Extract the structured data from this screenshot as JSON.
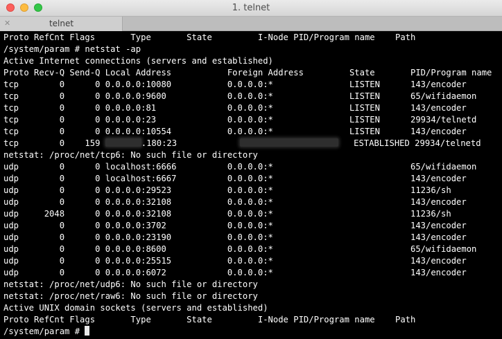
{
  "window": {
    "title": "1. telnet"
  },
  "tab": {
    "label": "telnet",
    "close_glyph": "✕"
  },
  "terminal": {
    "lines": [
      "Proto RefCnt Flags       Type       State         I-Node PID/Program name    Path",
      "/system/param # netstat -ap",
      "Active Internet connections (servers and established)",
      "Proto Recv-Q Send-Q Local Address           Foreign Address         State       PID/Program name",
      "tcp        0      0 0.0.0.0:10080           0.0.0.0:*               LISTEN      143/encoder",
      "tcp        0      0 0.0.0.0:9600            0.0.0.0:*               LISTEN      65/wifidaemon",
      "tcp        0      0 0.0.0.0:81              0.0.0.0:*               LISTEN      143/encoder",
      "tcp        0      0 0.0.0.0:23              0.0.0.0:*               LISTEN      29934/telnetd",
      "tcp        0      0 0.0.0.0:10554           0.0.0.0:*               LISTEN      143/encoder"
    ],
    "redacted_line": {
      "prefix": "tcp        0    159 ",
      "local_suffix": ".180:23",
      "suffix": "ESTABLISHED 29934/telnetd"
    },
    "lines_after": [
      "netstat: /proc/net/tcp6: No such file or directory",
      "udp        0      0 localhost:6666          0.0.0.0:*                           65/wifidaemon",
      "udp        0      0 localhost:6667          0.0.0.0:*                           143/encoder",
      "udp        0      0 0.0.0.0:29523           0.0.0.0:*                           11236/sh",
      "udp        0      0 0.0.0.0:32108           0.0.0.0:*                           143/encoder",
      "udp     2048      0 0.0.0.0:32108           0.0.0.0:*                           11236/sh",
      "udp        0      0 0.0.0.0:3702            0.0.0.0:*                           143/encoder",
      "udp        0      0 0.0.0.0:23190           0.0.0.0:*                           143/encoder",
      "udp        0      0 0.0.0.0:8600            0.0.0.0:*                           65/wifidaemon",
      "udp        0      0 0.0.0.0:25515           0.0.0.0:*                           143/encoder",
      "udp        0      0 0.0.0.0:6072            0.0.0.0:*                           143/encoder",
      "netstat: /proc/net/udp6: No such file or directory",
      "netstat: /proc/net/raw6: No such file or directory",
      "Active UNIX domain sockets (servers and established)",
      "Proto RefCnt Flags       Type       State         I-Node PID/Program name    Path"
    ],
    "prompt": "/system/param # "
  },
  "colors": {
    "terminal_bg": "#000000",
    "terminal_fg": "#ffffff",
    "close_button": "#fc605c",
    "minimize_button": "#fdbc40",
    "zoom_button": "#34c749"
  }
}
